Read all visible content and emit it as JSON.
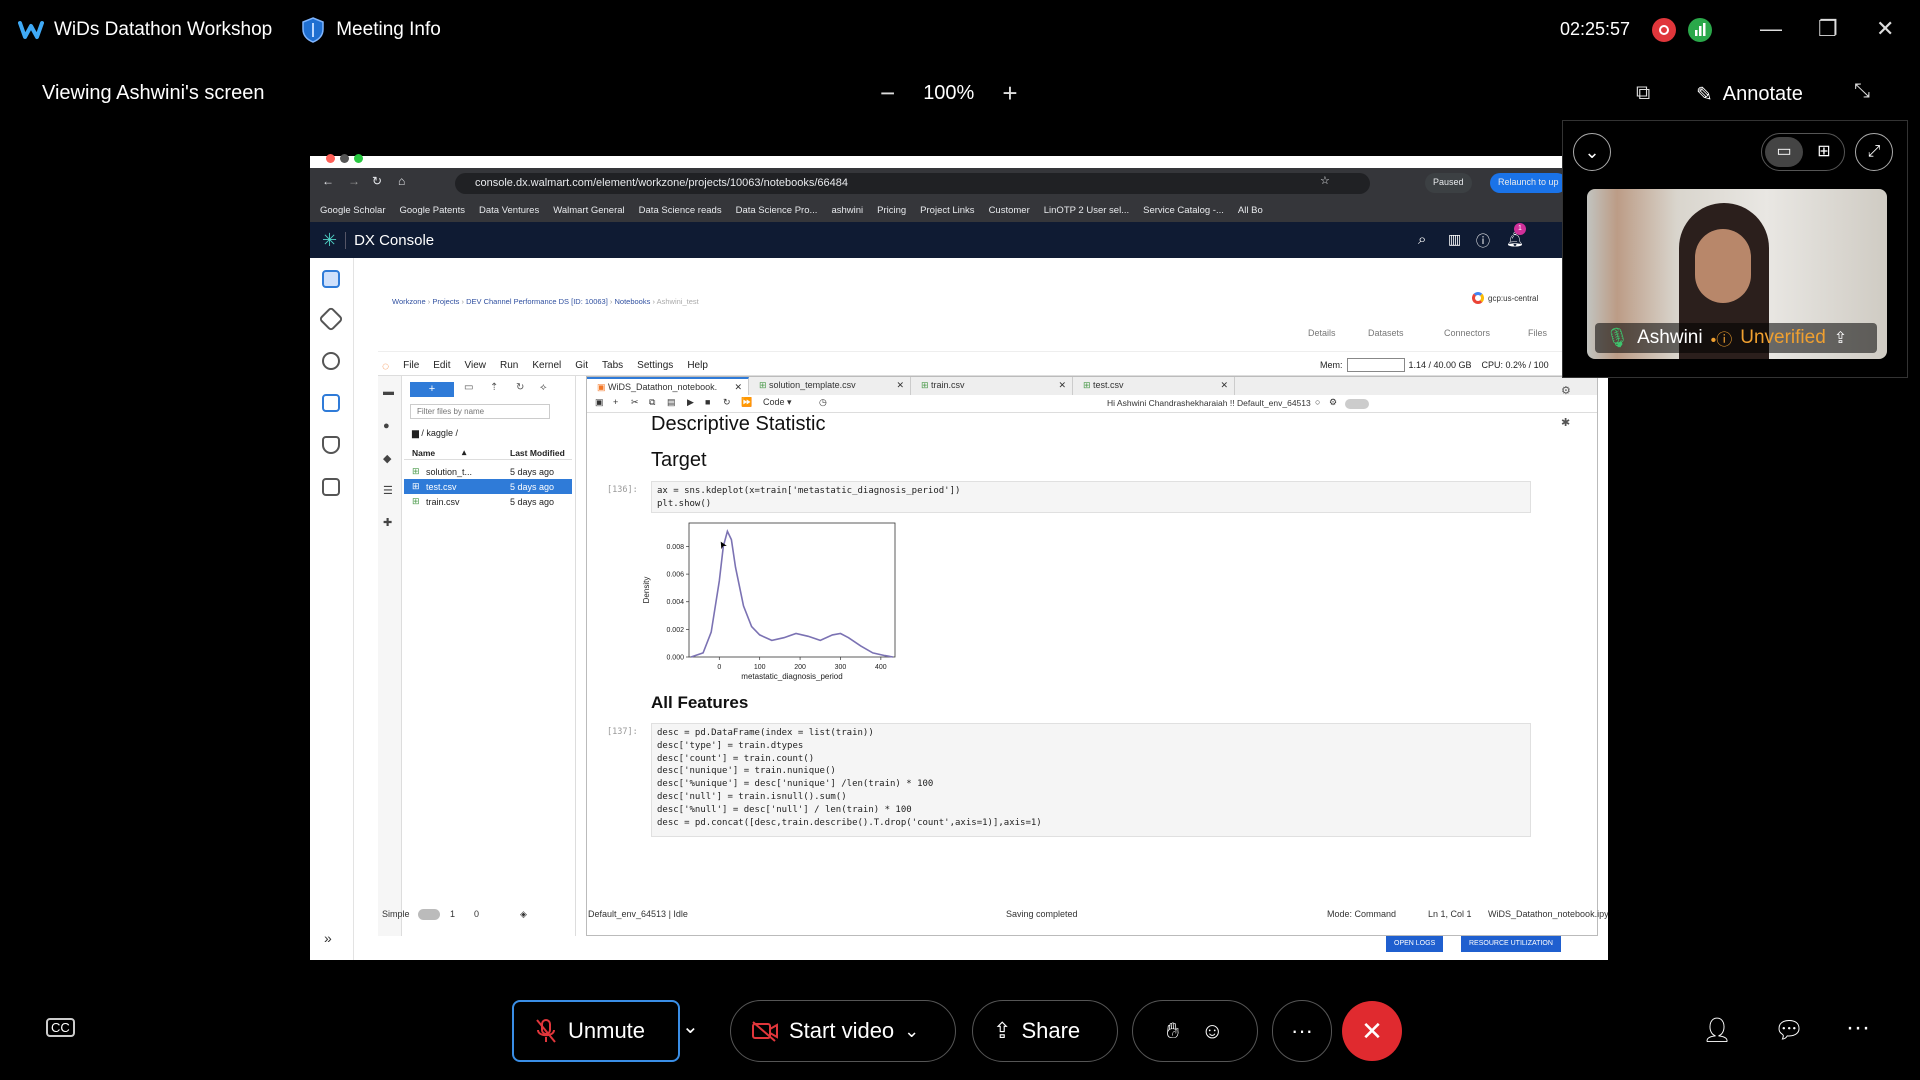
{
  "app": {
    "title": "WiDs Datathon Workshop",
    "meeting_info": "Meeting Info",
    "clock": "02:25:57"
  },
  "view": {
    "viewing": "Viewing Ashwini's screen",
    "zoom_level": "100%",
    "zoom_minus": "−",
    "zoom_plus": "+",
    "annotate": "Annotate"
  },
  "browser": {
    "url": "console.dx.walmart.com/element/workzone/projects/10063/notebooks/66484",
    "paused": "Paused",
    "relaunch": "Relaunch to up",
    "bookmarks": [
      "Google Scholar",
      "Google Patents",
      "Data Ventures",
      "Walmart General",
      "Data Science reads",
      "Data Science Pro...",
      "ashwini",
      "Pricing",
      "Project Links",
      "Customer",
      "LinOTP 2 User sel...",
      "Service Catalog -...",
      "All Bo"
    ]
  },
  "dx": {
    "title": "DX Console",
    "notif_count": "1",
    "breadcrumb": [
      "Workzone",
      "Projects",
      "DEV Channel Performance DS [ID: 10063]",
      "Notebooks",
      "Ashwini_test"
    ],
    "region": "gcp:us-central",
    "subtabs": [
      "Details",
      "Datasets",
      "Connectors",
      "Files"
    ]
  },
  "jupyter": {
    "menu": [
      "File",
      "Edit",
      "View",
      "Run",
      "Kernel",
      "Git",
      "Tabs",
      "Settings",
      "Help"
    ],
    "mem_label": "Mem:",
    "mem_value": "1.14 / 40.00 GB",
    "cpu": "CPU: 0.2% / 100",
    "filter_placeholder": "Filter files by name",
    "path": "/ kaggle /",
    "columns": [
      "Name",
      "Last Modified"
    ],
    "files": [
      {
        "name": "solution_t...",
        "modified": "5 days ago",
        "selected": false
      },
      {
        "name": "test.csv",
        "modified": "5 days ago",
        "selected": true
      },
      {
        "name": "train.csv",
        "modified": "5 days ago",
        "selected": false
      }
    ],
    "tabs": [
      "WiDS_Datathon_notebook.",
      "solution_template.csv",
      "train.csv",
      "test.csv"
    ],
    "cell_type": "Code",
    "greeting": "Hi Ashwini Chandrashekharaiah !!",
    "env": "Default_env_64513",
    "heading1": "Descriptive Statistic",
    "heading2": "Target",
    "prompt1": "[136]:",
    "code1": "ax = sns.kdeplot(x=train['metastatic_diagnosis_period'])\nplt.show()",
    "heading3": "All Features",
    "prompt2": "[137]:",
    "code2": "desc = pd.DataFrame(index = list(train))\ndesc['type'] = train.dtypes\ndesc['count'] = train.count()\ndesc['nunique'] = train.nunique()\ndesc['%unique'] = desc['nunique'] /len(train) * 100\ndesc['null'] = train.isnull().sum()\ndesc['%null'] = desc['null'] / len(train) * 100\ndesc = pd.concat([desc,train.describe().T.drop('count',axis=1)],axis=1)",
    "status": {
      "simple": "Simple",
      "n1": "1",
      "n2": "0",
      "env_status": "Default_env_64513 | Idle",
      "saving": "Saving completed",
      "mode": "Mode: Command",
      "pos": "Ln 1, Col 1",
      "file": "WiDS_Datathon_notebook.ipynb"
    },
    "open_logs": "OPEN LOGS",
    "resource": "RESOURCE UTILIZATION"
  },
  "chart_data": {
    "type": "line",
    "xlabel": "metastatic_diagnosis_period",
    "ylabel": "Density",
    "xticks": [
      0,
      100,
      200,
      300,
      400
    ],
    "yticks": [
      "0.000",
      "0.002",
      "0.004",
      "0.006",
      "0.008"
    ],
    "xlim": [
      -75,
      435
    ],
    "ylim": [
      0,
      0.0097
    ],
    "x": [
      -70,
      -40,
      -20,
      0,
      10,
      20,
      30,
      40,
      60,
      80,
      100,
      130,
      160,
      190,
      220,
      250,
      280,
      300,
      320,
      350,
      380,
      410,
      430
    ],
    "y": [
      0.0,
      0.0003,
      0.0018,
      0.0055,
      0.008,
      0.0091,
      0.0085,
      0.0065,
      0.0037,
      0.0022,
      0.0016,
      0.0012,
      0.0014,
      0.0017,
      0.0015,
      0.0012,
      0.0016,
      0.0017,
      0.0014,
      0.0008,
      0.0003,
      0.0001,
      0.0
    ],
    "color": "#7b72b3"
  },
  "participant": {
    "name": "Ashwini",
    "status": "Unverified"
  },
  "controls": {
    "unmute": "Unmute",
    "start_video": "Start video",
    "share": "Share",
    "more": "···"
  },
  "colors": {
    "accent_blue": "#2f7bd8",
    "leave_red": "#e02a2f",
    "warning_orange": "#f0a030"
  }
}
